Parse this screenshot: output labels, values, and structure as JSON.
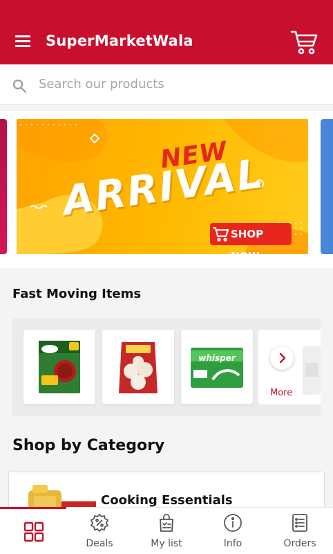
{
  "app": {
    "title": "SuperMarketWala",
    "accent_color": "#c8102e"
  },
  "header": {
    "menu_icon": "hamburger-menu-icon",
    "cart_icon": "shopping-cart-icon"
  },
  "search": {
    "placeholder": "Search our products",
    "value": "",
    "icon": "search-icon"
  },
  "banner": {
    "line1": "NEW",
    "line2": "ARRIVAL",
    "cta": "SHOP NOW"
  },
  "fast_moving": {
    "title": "Fast Moving Items",
    "items": [
      {
        "name": "Knorr Cup a Soup Hot & Sour Veg"
      },
      {
        "name": "Haldiram's Papad"
      },
      {
        "name": "Whisper sanitary pads"
      }
    ],
    "more_label": "More"
  },
  "category_section": {
    "title": "Shop by Category",
    "categories": [
      {
        "label": "Cooking Essentials"
      }
    ]
  },
  "bottom_nav": {
    "items": [
      {
        "label": "",
        "icon": "home-grid-icon",
        "active": true
      },
      {
        "label": "Deals",
        "icon": "deals-badge-icon"
      },
      {
        "label": "My list",
        "icon": "shopping-list-bag-icon"
      },
      {
        "label": "Info",
        "icon": "info-icon"
      },
      {
        "label": "Orders",
        "icon": "orders-list-icon"
      }
    ]
  }
}
